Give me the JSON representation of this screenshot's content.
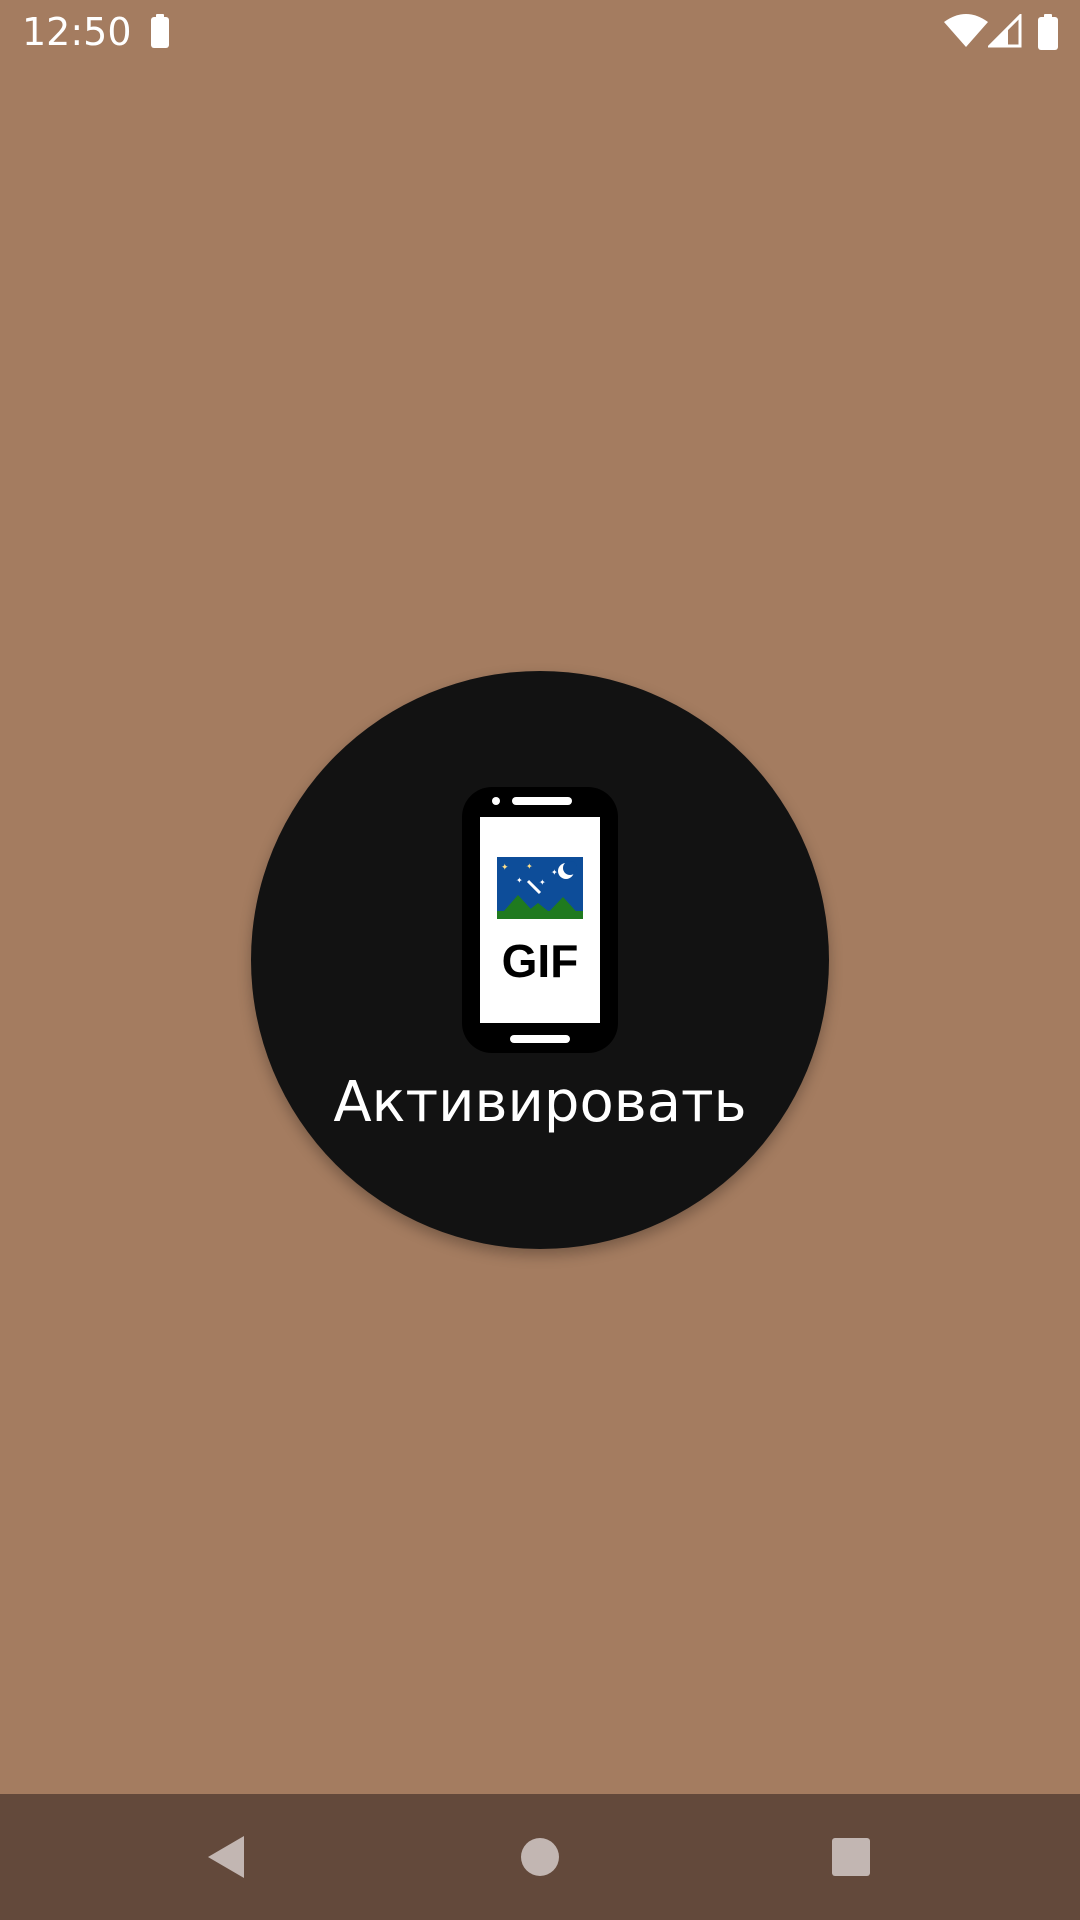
{
  "status_bar": {
    "time": "12:50",
    "icons": [
      "battery-small-icon",
      "wifi-icon",
      "signal-icon",
      "battery-icon"
    ]
  },
  "main": {
    "activate_button": {
      "label": "Активировать",
      "icon": "phone-gif-icon",
      "icon_text": "GIF"
    }
  },
  "nav_bar": {
    "buttons": [
      "back-icon",
      "home-icon",
      "recents-icon"
    ]
  },
  "colors": {
    "background": "#a47c60",
    "circle": "#121212",
    "nav_bar": "#63493b",
    "nav_icons": "#c2b6b2",
    "sky": "#0d4d99",
    "grass": "#1f7a1f"
  }
}
